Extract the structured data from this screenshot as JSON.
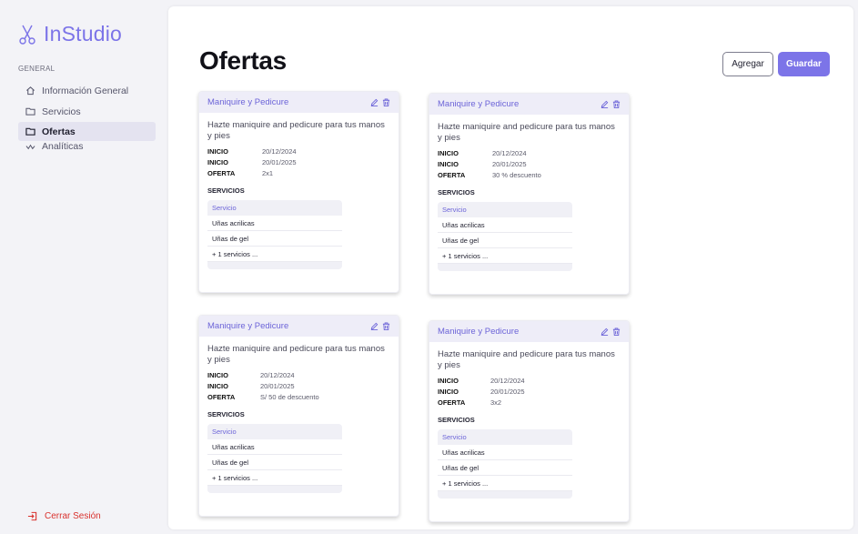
{
  "app": {
    "name": "InStudio"
  },
  "sidebar": {
    "section": "GENERAL",
    "items": [
      {
        "label": "Información General",
        "icon": "home-icon"
      },
      {
        "label": "Servicios",
        "icon": "folder-icon"
      },
      {
        "label": "Ofertas",
        "icon": "folder-icon",
        "active": true
      },
      {
        "label": "Analíticas",
        "icon": "activity-icon"
      }
    ],
    "logout": "Cerrar Sesión"
  },
  "page": {
    "title": "Ofertas",
    "add_label": "Agregar",
    "save_label": "Guardar"
  },
  "colors": {
    "accent": "#7c74e8",
    "danger": "#d9322e",
    "card_header": "#eeedf8"
  },
  "offers": [
    {
      "title": "Maniquire y Pedicure",
      "description": "Hazte maniquire and pedicure para tus manos y pies",
      "start_label": "INICIO",
      "start": "20/12/2024",
      "end_label": "INICIO",
      "end": "20/01/2025",
      "offer_label": "OFERTA",
      "offer": "2x1",
      "services_label": "SERVICIOS",
      "services_header": "Servicio",
      "services": [
        "Uñas acrilicas",
        "Uñas de gel",
        "+ 1 servicios ..."
      ]
    },
    {
      "title": "Maniquire y Pedicure",
      "description": "Hazte maniquire and pedicure para tus manos y pies",
      "start_label": "INICIO",
      "start": "20/12/2024",
      "end_label": "INICIO",
      "end": "20/01/2025",
      "offer_label": "OFERTA",
      "offer": "30 % descuento",
      "services_label": "SERVICIOS",
      "services_header": "Servicio",
      "services": [
        "Uñas acrilicas",
        "Uñas de gel",
        "+ 1 servicios ..."
      ]
    },
    {
      "title": "Maniquire y Pedicure",
      "description": "Hazte maniquire and pedicure para tus manos y pies",
      "start_label": "INICIO",
      "start": "20/12/2024",
      "end_label": "INICIO",
      "end": "20/01/2025",
      "offer_label": "OFERTA",
      "offer": "S/ 50 de descuento",
      "services_label": "SERVICIOS",
      "services_header": "Servicio",
      "services": [
        "Uñas acrilicas",
        "Uñas de gel",
        "+ 1 servicios ..."
      ]
    },
    {
      "title": "Maniquire y Pedicure",
      "description": "Hazte maniquire and pedicure para tus manos y pies",
      "start_label": "INICIO",
      "start": "20/12/2024",
      "end_label": "INICIO",
      "end": "20/01/2025",
      "offer_label": "OFERTA",
      "offer": "3x2",
      "services_label": "SERVICIOS",
      "services_header": "Servicio",
      "services": [
        "Uñas acrilicas",
        "Uñas de gel",
        "+ 1 servicios ..."
      ]
    }
  ]
}
